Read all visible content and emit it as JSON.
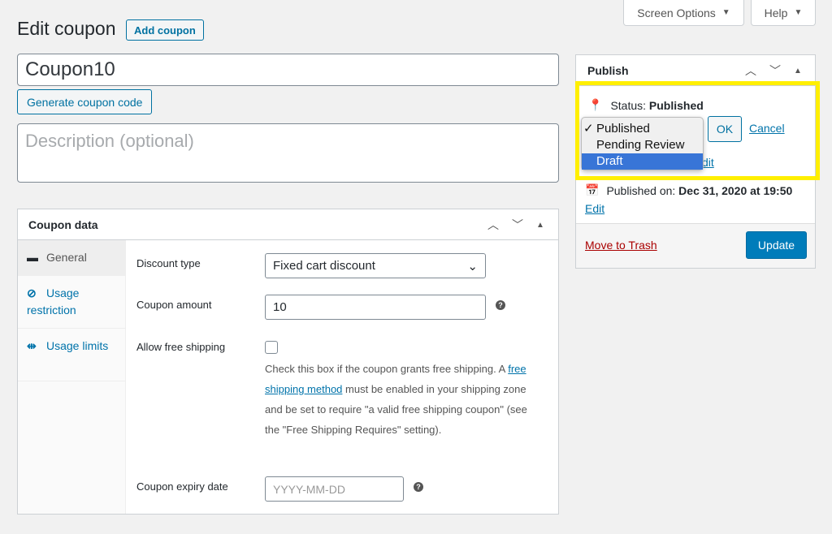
{
  "top_tabs": {
    "screen_options": "Screen Options",
    "help": "Help"
  },
  "header": {
    "title": "Edit coupon",
    "add_button": "Add coupon"
  },
  "coupon": {
    "code": "Coupon10",
    "generate_button": "Generate coupon code",
    "description_placeholder": "Description (optional)"
  },
  "coupon_data": {
    "title": "Coupon data",
    "tabs": [
      {
        "label": "General",
        "icon": "ticket-icon"
      },
      {
        "label": "Usage restriction",
        "icon": "block-icon"
      },
      {
        "label": "Usage limits",
        "icon": "arrows-icon"
      }
    ],
    "fields": {
      "discount_type_label": "Discount type",
      "discount_type_value": "Fixed cart discount",
      "amount_label": "Coupon amount",
      "amount_value": "10",
      "free_shipping_label": "Allow free shipping",
      "free_shipping_desc_1": "Check this box if the coupon grants free shipping. A",
      "free_shipping_link": "free shipping method",
      "free_shipping_desc_2": "must be enabled in your shipping zone and be set to require \"a valid free shipping coupon\" (see the \"Free Shipping Requires\" setting).",
      "expiry_label": "Coupon expiry date",
      "expiry_placeholder": "YYYY-MM-DD"
    }
  },
  "publish": {
    "title": "Publish",
    "status_label": "Status:",
    "status_value": "Published",
    "options": [
      "Published",
      "Pending Review",
      "Draft"
    ],
    "selected_option": "Published",
    "highlighted_option": "Draft",
    "ok_button": "OK",
    "cancel_link": "Cancel",
    "edit_fragment": "dit",
    "published_on_label": "Published on:",
    "published_on_value": "Dec 31, 2020 at 19:50",
    "edit_link": "Edit",
    "trash_link": "Move to Trash",
    "update_button": "Update"
  },
  "colors": {
    "accent": "#007cba",
    "highlight": "#ffef00",
    "link": "#0073aa",
    "trash": "#aa0000"
  }
}
